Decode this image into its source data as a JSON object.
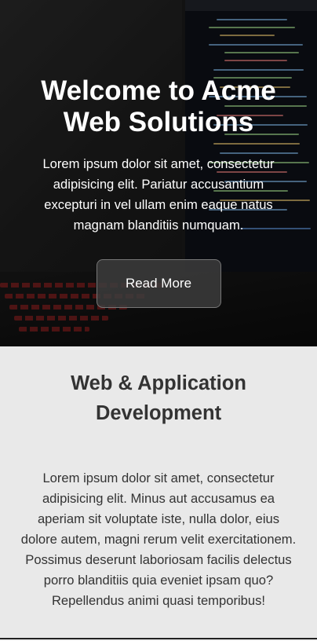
{
  "hero": {
    "title": "Welcome to Acme Web Solutions",
    "text": "Lorem ipsum dolor sit amet, consectetur adipisicing elit. Pariatur accusantium excepturi in vel ullam enim eaque natus magnam blanditiis numquam.",
    "button_label": "Read More"
  },
  "section": {
    "title": "Web & Application Development",
    "text": "Lorem ipsum dolor sit amet, consectetur adipisicing elit. Minus aut accusamus ea aperiam sit voluptate iste, nulla dolor, eius dolore autem, magni rerum velit exercitationem. Possimus deserunt laboriosam facilis delectus porro blanditiis quia eveniet ipsam quo? Repellendus animi quasi temporibus!"
  },
  "colors": {
    "section_background": "#e9e9e9",
    "text": "#333333",
    "hero_text": "#ffffff"
  }
}
